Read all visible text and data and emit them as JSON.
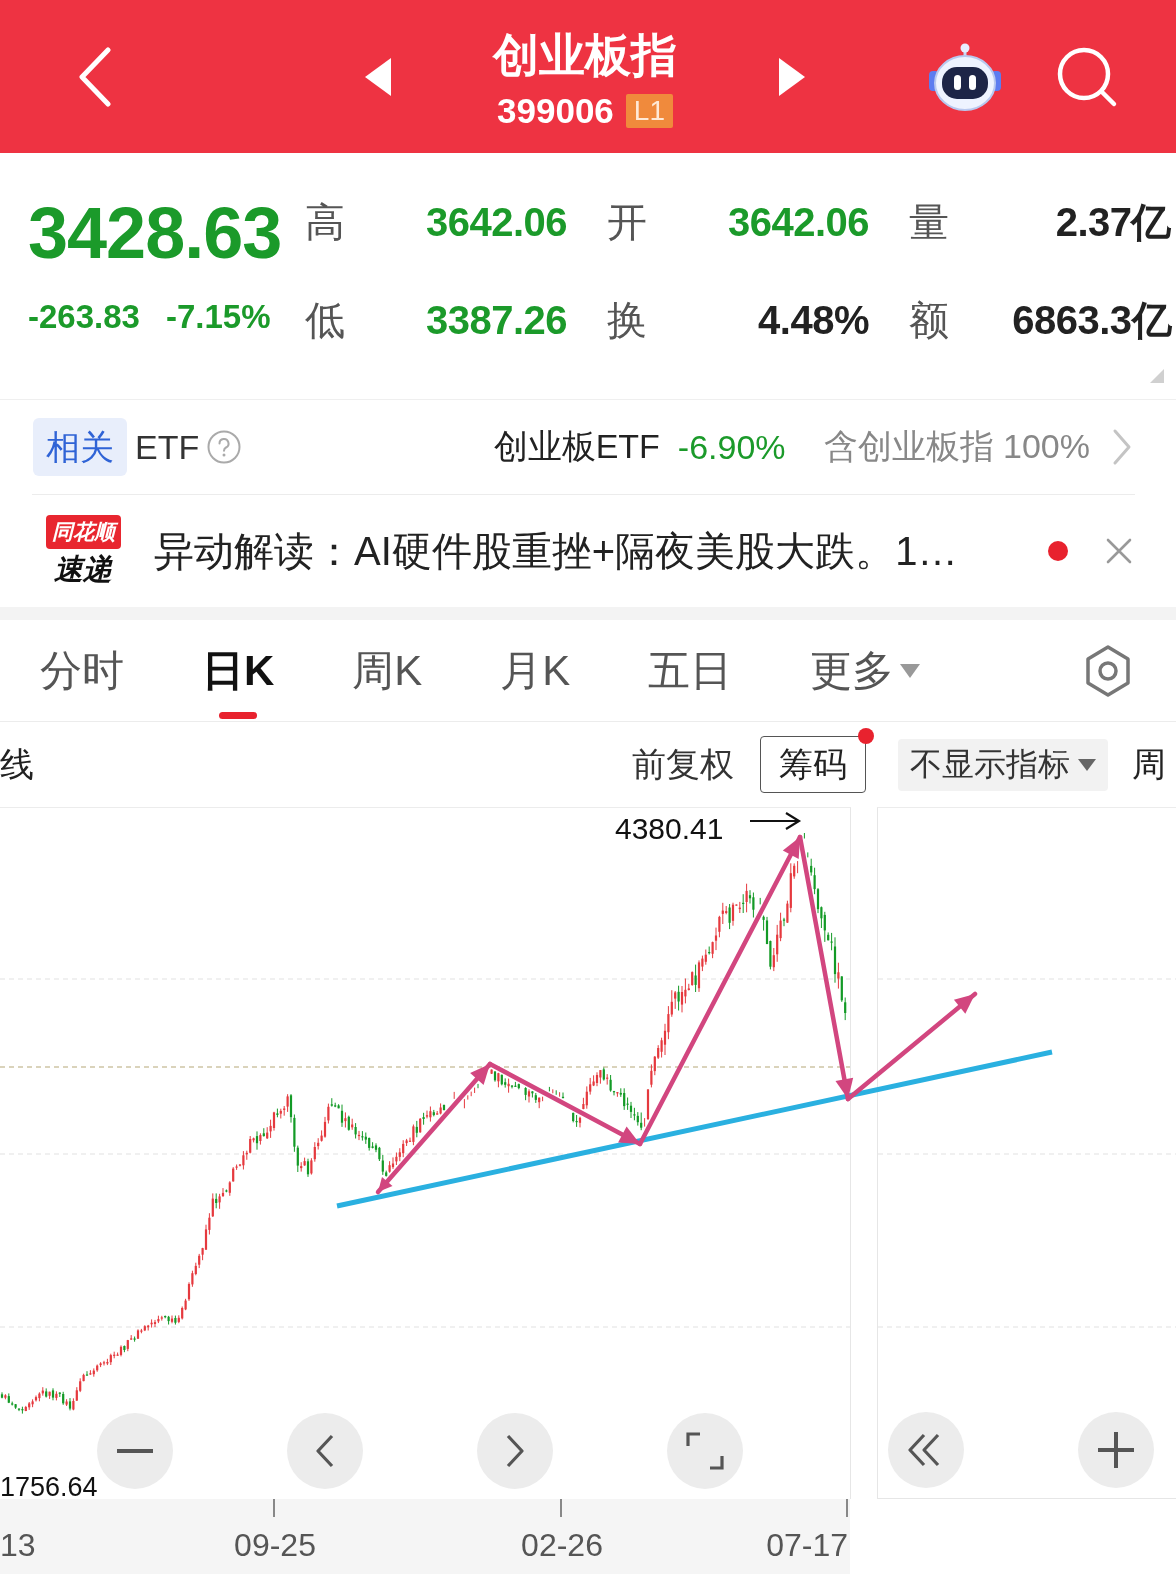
{
  "header": {
    "title": "创业板指",
    "code": "399006",
    "level_badge": "L1"
  },
  "quote": {
    "price": "3428.63",
    "change": "-263.83",
    "change_percent": "-7.15%",
    "falling": true,
    "stats": [
      {
        "label": "高",
        "value": "3642.06",
        "color": "#1b9a2a"
      },
      {
        "label": "开",
        "value": "3642.06",
        "color": "#1b9a2a"
      },
      {
        "label": "量",
        "value": "2.37亿",
        "color": "#222222"
      },
      {
        "label": "低",
        "value": "3387.26",
        "color": "#1b9a2a"
      },
      {
        "label": "换",
        "value": "4.48%",
        "color": "#222222"
      },
      {
        "label": "额",
        "value": "6863.3亿",
        "color": "#222222"
      }
    ]
  },
  "etf": {
    "tag": "相关",
    "label": "ETF",
    "fund_name": "创业板ETF",
    "fund_change": "-6.90%",
    "fund_falling": true,
    "holding_note": "含创业板指 100%"
  },
  "news": {
    "logo_top": "同花顺",
    "logo_bottom": "速递",
    "headline": "异动解读：AI硬件股重挫+隔夜美股大跌。1…",
    "unread": true
  },
  "tabs": [
    {
      "label": "分时",
      "selected": false,
      "dropdown": false
    },
    {
      "label": "日K",
      "selected": true,
      "dropdown": false
    },
    {
      "label": "周K",
      "selected": false,
      "dropdown": false
    },
    {
      "label": "月K",
      "selected": false,
      "dropdown": false
    },
    {
      "label": "五日",
      "selected": false,
      "dropdown": false
    },
    {
      "label": "更多",
      "selected": false,
      "dropdown": true
    }
  ],
  "toolbar": {
    "left_cut_label": "线",
    "adjust_label": "前复权",
    "chips_button": "筹码",
    "chips_badge": true,
    "indicator_select": "不显示指标",
    "right_cut_label": "周"
  },
  "chart": {
    "high_label": "4380.41",
    "low_label": "1756.64",
    "x_labels": [
      "13",
      "09-25",
      "02-26",
      "07-17"
    ]
  }
}
